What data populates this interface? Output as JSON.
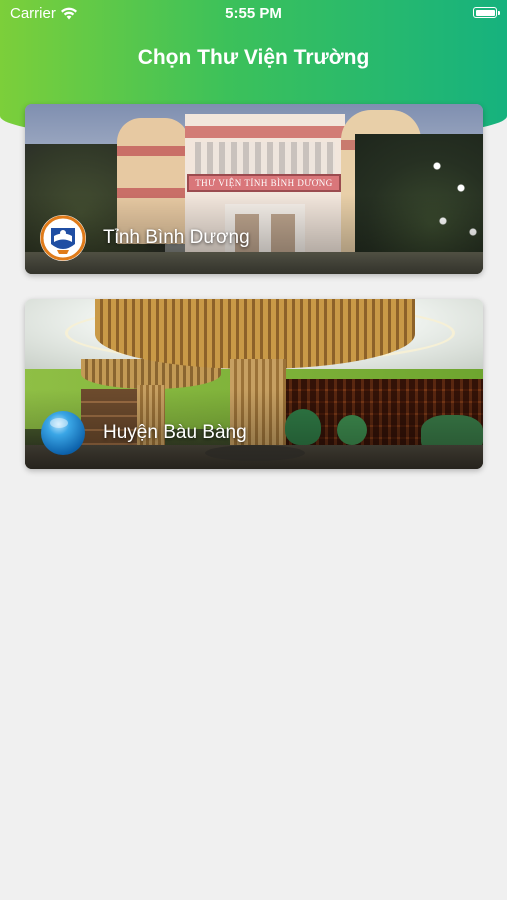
{
  "status_bar": {
    "carrier": "Carrier",
    "time": "5:55 PM",
    "wifi_icon": "wifi-icon",
    "battery_icon": "battery-icon"
  },
  "header": {
    "title": "Chọn Thư Viện Trường",
    "gradient_colors": [
      "#7ccf3a",
      "#3cc15a",
      "#16b27e"
    ]
  },
  "libraries": [
    {
      "label": "Tỉnh Bình Dương",
      "sign_text": "THƯ VIỆN TỈNH BÌNH DƯƠNG",
      "logo_icon": "library-emblem-icon"
    },
    {
      "label": "Huyện Bàu Bàng",
      "logo_icon": "blue-sphere-icon"
    }
  ],
  "background_color": "#f0f0f0"
}
